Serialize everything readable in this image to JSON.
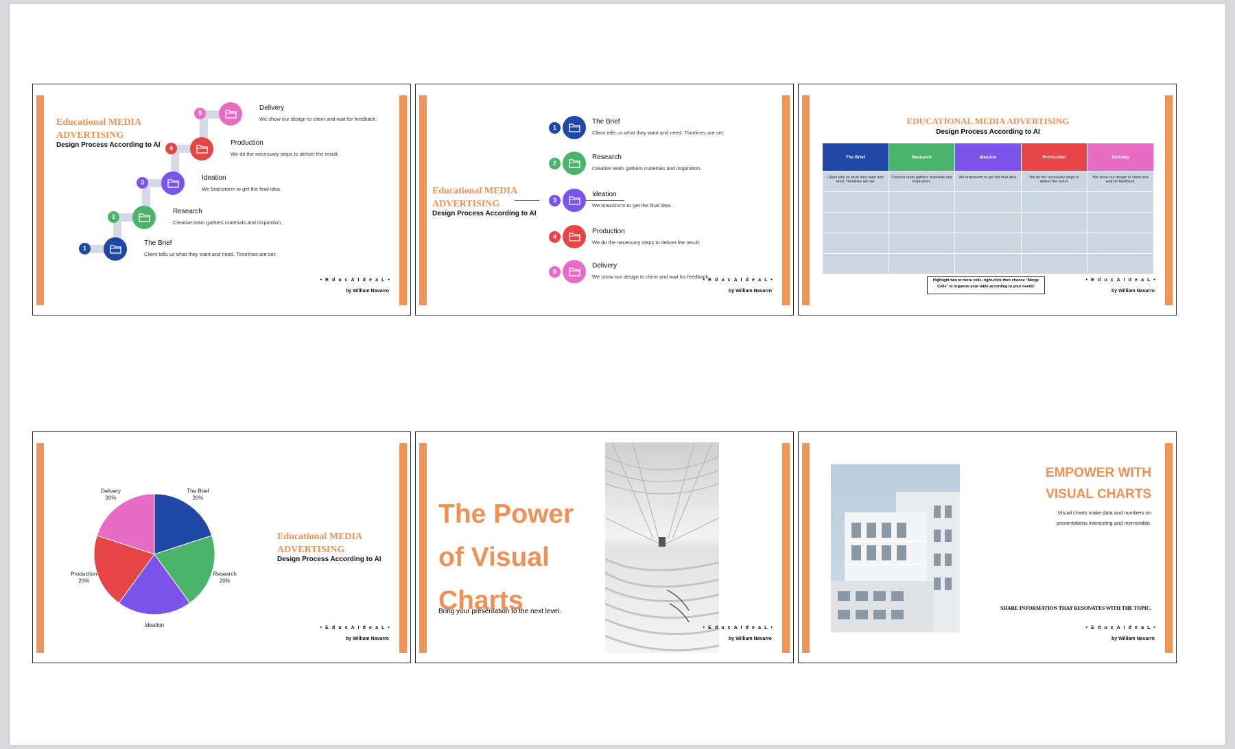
{
  "colors": {
    "accent": "#f0945a",
    "brief": "#1f47a5",
    "research": "#4cb46a",
    "ideation": "#7b54ee",
    "production": "#e64545",
    "delivery": "#e86cc4",
    "table_body": "#ccd5e2"
  },
  "common": {
    "title_line1": "Educational MEDIA",
    "title_line2": "ADVERTISING",
    "subtitle": "Design Process According to AI",
    "brand": "• E d u c A I d e a L •",
    "byline": "by William Navarro"
  },
  "steps": [
    {
      "num": "1",
      "name": "The Brief",
      "desc": "Client tells us what they want and need. Timelines are set.",
      "color": "#1f47a5",
      "icon": "folder-icon"
    },
    {
      "num": "2",
      "name": "Research",
      "desc": "Creative team gathers materials and inspiration.",
      "color": "#4cb46a",
      "icon": "folder-icon"
    },
    {
      "num": "3",
      "name": "Ideation",
      "desc": "We brainstorm to get the final idea.",
      "color": "#7b54ee",
      "icon": "folder-icon"
    },
    {
      "num": "4",
      "name": "Production",
      "desc": "We do the necessary steps to deliver the result.",
      "color": "#e64545",
      "icon": "folder-icon"
    },
    {
      "num": "5",
      "name": "Delivery",
      "desc": "We show our design to client and wait for feedback.",
      "color": "#e86cc4",
      "icon": "folder-icon"
    }
  ],
  "slide3": {
    "title": "EDUCATIONAL MEDIA ADVERTISING",
    "subtitle": "Design Process According to AI",
    "headers": [
      "The Brief",
      "Research",
      "Ideation",
      "Production",
      "Delivery"
    ],
    "row1": [
      "Client tells us what they want and need. Timelines are set.",
      "Creative team gathers materials and inspiration.",
      "We brainstorm to get the final idea.",
      "We do the necessary steps to deliver the result.",
      "We show our design to client and wait for feedback."
    ],
    "note": "Highlight two or more cells, right-click then choose \"Merge Cells\" to organize your table according to your needs!"
  },
  "slide4": {
    "chart_data": {
      "type": "pie",
      "categories": [
        "The Brief",
        "Research",
        "Ideation",
        "Production",
        "Delivery"
      ],
      "values": [
        20,
        20,
        20,
        20,
        20
      ],
      "labels": [
        "20%",
        "20%",
        "20%",
        "20%",
        "20%"
      ],
      "colors": [
        "#1f47a5",
        "#4cb46a",
        "#7b54ee",
        "#e64545",
        "#e86cc4"
      ]
    }
  },
  "slide5": {
    "heading_line1": "The Power",
    "heading_line2": "of Visual",
    "heading_line3": "Charts",
    "tagline": "Bring your presentation to the next level."
  },
  "slide6": {
    "heading_line1": "EMPOWER WITH",
    "heading_line2": "VISUAL CHARTS",
    "desc_line1": "Visual charts make data and numbers on",
    "desc_line2": "presentations interesting and memorable.",
    "share": "SHARE INFORMATION THAT RESONATES WITH THE TOPIC."
  }
}
